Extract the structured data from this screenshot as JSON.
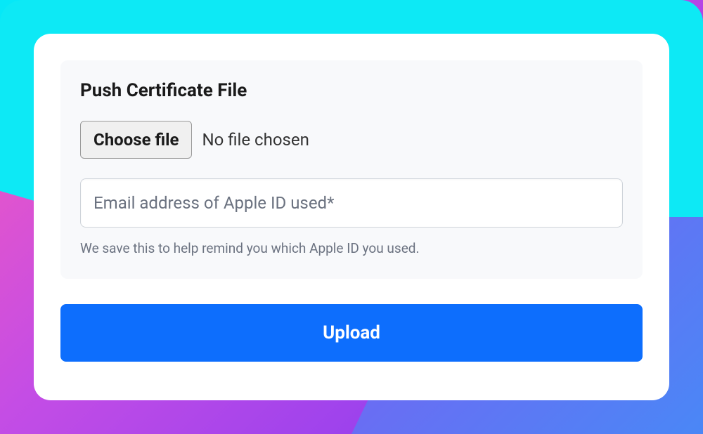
{
  "form": {
    "title": "Push Certificate File",
    "file_picker": {
      "button_label": "Choose file",
      "status": "No file chosen"
    },
    "email": {
      "placeholder": "Email address of Apple ID used*",
      "value": ""
    },
    "helper_text": "We save this to help remind you which Apple ID you used."
  },
  "actions": {
    "upload_label": "Upload"
  }
}
